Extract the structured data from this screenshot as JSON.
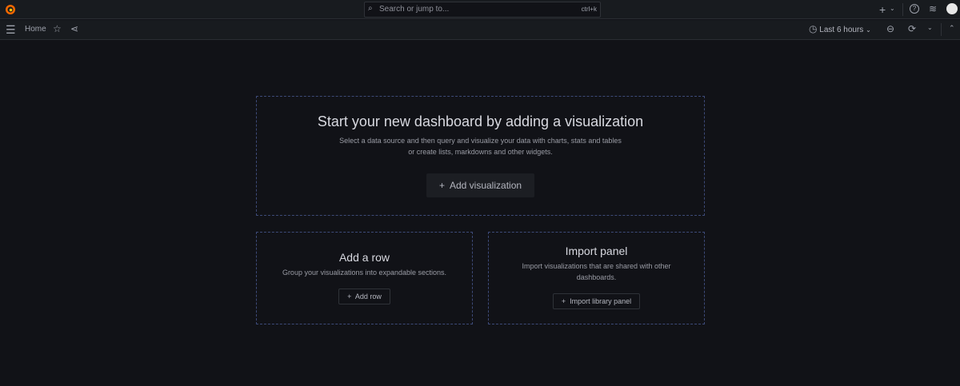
{
  "topbar": {
    "search_placeholder": "Search or jump to...",
    "shortcut": "ctrl+k"
  },
  "nav": {
    "breadcrumb": "Home",
    "time_range": "Last 6 hours"
  },
  "main": {
    "title": "Start your new dashboard by adding a visualization",
    "desc1": "Select a data source and then query and visualize your data with charts, stats and tables",
    "desc2": "or create lists, markdowns and other widgets.",
    "add_viz": "Add visualization"
  },
  "row": {
    "title": "Add a row",
    "desc": "Group your visualizations into expandable sections.",
    "button": "Add row"
  },
  "import": {
    "title": "Import panel",
    "desc1": "Import visualizations that are shared with other",
    "desc2": "dashboards.",
    "button": "Import library panel"
  },
  "colors": {
    "bg": "#111217",
    "bar": "#181b1f",
    "logo": "#f46800"
  }
}
